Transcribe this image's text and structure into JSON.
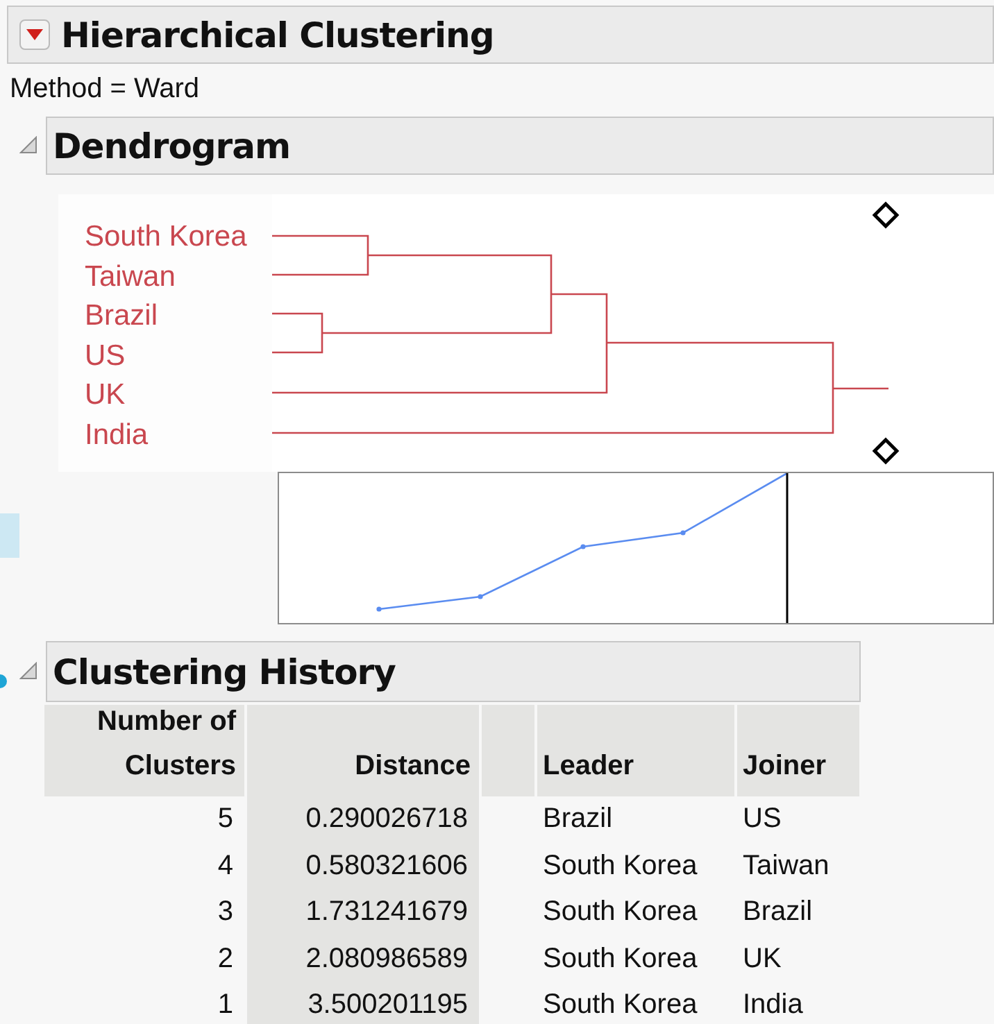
{
  "report": {
    "title": "Hierarchical Clustering",
    "method": "Method = Ward"
  },
  "dendrogram": {
    "title": "Dendrogram",
    "expanded": true,
    "leaves": [
      "South Korea",
      "Taiwan",
      "Brazil",
      "US",
      "UK",
      "India"
    ]
  },
  "history": {
    "title": "Clustering History",
    "expanded": true,
    "columns": [
      "Number of Clusters",
      "Distance",
      "Leader",
      "Joiner"
    ],
    "rows": [
      {
        "clusters": "5",
        "distance": "0.290026718",
        "leader": "Brazil",
        "joiner": "US"
      },
      {
        "clusters": "4",
        "distance": "0.580321606",
        "leader": "South Korea",
        "joiner": "Taiwan"
      },
      {
        "clusters": "3",
        "distance": "1.731241679",
        "leader": "South Korea",
        "joiner": "Brazil"
      },
      {
        "clusters": "2",
        "distance": "2.080986589",
        "leader": "South Korea",
        "joiner": "UK"
      },
      {
        "clusters": "1",
        "distance": "3.500201195",
        "leader": "South Korea",
        "joiner": "India"
      }
    ]
  }
}
